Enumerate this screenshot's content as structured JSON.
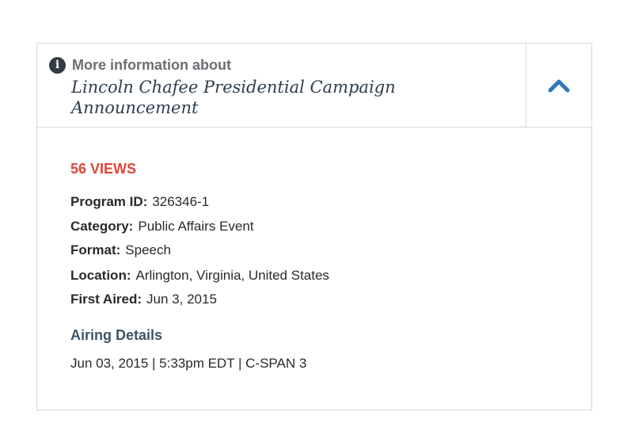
{
  "header": {
    "more_info_label": "More information about",
    "info_icon_glyph": "i",
    "program_title": "Lincoln Chafee Presidential Campaign Announcement",
    "toggle_icon": "chevron-up-icon"
  },
  "details": {
    "views": "56 VIEWS",
    "rows": [
      {
        "label": "Program ID:",
        "value": "326346-1"
      },
      {
        "label": "Category:",
        "value": "Public Affairs Event"
      },
      {
        "label": "Format:",
        "value": "Speech"
      },
      {
        "label": "Location:",
        "value": "Arlington, Virginia, United States"
      },
      {
        "label": "First Aired:",
        "value": "Jun 3, 2015"
      }
    ]
  },
  "airing": {
    "heading": "Airing Details",
    "line": "Jun 03, 2015 | 5:33pm EDT | C-SPAN 3"
  },
  "colors": {
    "views": "#e0463a",
    "chevron": "#2f7ab8",
    "title": "#2d3e50",
    "border": "#d9d9d9"
  }
}
